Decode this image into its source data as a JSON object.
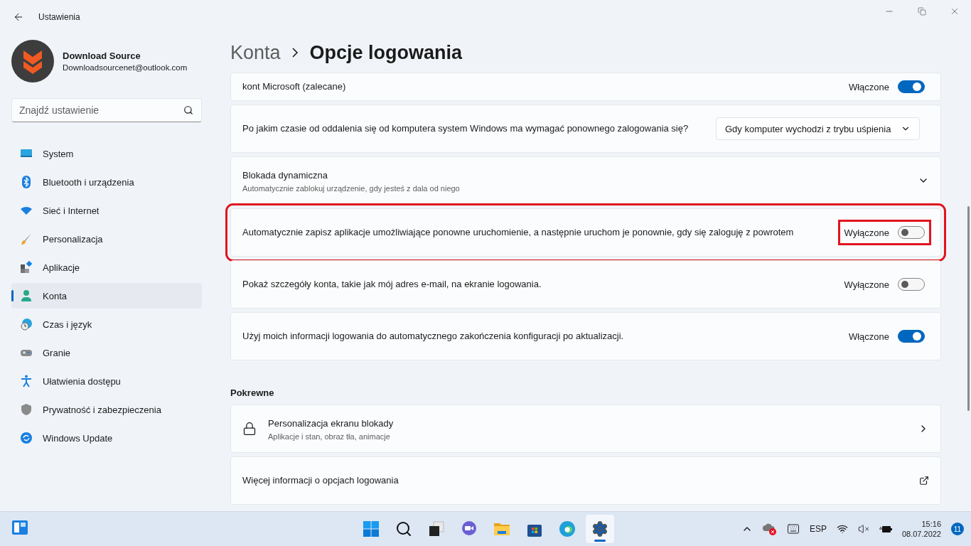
{
  "window": {
    "title": "Ustawienia"
  },
  "account": {
    "name": "Download Source",
    "email": "Downloadsourcenet@outlook.com"
  },
  "search": {
    "placeholder": "Znajdź ustawienie"
  },
  "nav": [
    {
      "label": "System",
      "selected": false
    },
    {
      "label": "Bluetooth i urządzenia",
      "selected": false
    },
    {
      "label": "Sieć i Internet",
      "selected": false
    },
    {
      "label": "Personalizacja",
      "selected": false
    },
    {
      "label": "Aplikacje",
      "selected": false
    },
    {
      "label": "Konta",
      "selected": true
    },
    {
      "label": "Czas i język",
      "selected": false
    },
    {
      "label": "Granie",
      "selected": false
    },
    {
      "label": "Ułatwienia dostępu",
      "selected": false
    },
    {
      "label": "Prywatność i zabezpieczenia",
      "selected": false
    },
    {
      "label": "Windows Update",
      "selected": false
    }
  ],
  "breadcrumb": {
    "parent": "Konta",
    "current": "Opcje logowania"
  },
  "settings": [
    {
      "kind": "toggle",
      "label": "kont Microsoft (zalecane)",
      "state_text": "Włączone",
      "on": true,
      "highlighted": false
    },
    {
      "kind": "dropdown",
      "label": "Po jakim czasie od oddalenia się od komputera system Windows ma wymagać ponownego zalogowania się?",
      "value": "Gdy komputer wychodzi z trybu uśpienia"
    },
    {
      "kind": "expander",
      "label": "Blokada dynamiczna",
      "subtitle": "Automatycznie zablokuj urządzenie, gdy jesteś z dala od niego"
    },
    {
      "kind": "toggle",
      "label": "Automatycznie zapisz aplikacje umożliwiające ponowne uruchomienie, a następnie uruchom je ponownie, gdy się zaloguję z powrotem",
      "state_text": "Wyłączone",
      "on": false,
      "highlighted": true
    },
    {
      "kind": "toggle",
      "label": "Pokaż szczegóły konta, takie jak mój adres e-mail, na ekranie logowania.",
      "state_text": "Wyłączone",
      "on": false,
      "highlighted": false
    },
    {
      "kind": "toggle",
      "label": "Użyj moich informacji logowania do automatycznego zakończenia konfiguracji po aktualizacji.",
      "state_text": "Włączone",
      "on": true,
      "highlighted": false
    }
  ],
  "related": {
    "heading": "Pokrewne",
    "items": [
      {
        "kind": "chevron",
        "title": "Personalizacja ekranu blokady",
        "subtitle": "Aplikacje i stan, obraz tła, animacje"
      },
      {
        "kind": "external",
        "title": "Więcej informacji o opcjach logowania"
      }
    ]
  },
  "taskbar": {
    "apps": [
      {
        "selected": false
      },
      {
        "selected": false
      },
      {
        "selected": false
      },
      {
        "selected": false
      },
      {
        "selected": false
      },
      {
        "selected": false
      },
      {
        "selected": false
      },
      {
        "selected": true
      }
    ],
    "language": "ESP",
    "time": "15:16",
    "date": "08.07.2022",
    "notifications": "11"
  }
}
